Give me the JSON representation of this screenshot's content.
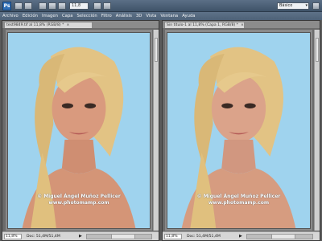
{
  "app": {
    "logo_text": "Ps",
    "zoom": "11,8",
    "workspace": "Básico"
  },
  "menu": [
    "Archivo",
    "Edición",
    "Imagen",
    "Capa",
    "Selección",
    "Filtro",
    "Análisis",
    "3D",
    "Vista",
    "Ventana",
    "Ayuda"
  ],
  "left_doc": {
    "tab_title": "test9849.tif al 11,8% (RGB/8) *",
    "close": "×",
    "watermark_line1": "© Miguel Ángel Muñoz Pellicer",
    "watermark_line2": "www.photomamp.com",
    "status_zoom": "11,8%",
    "status_info": "Doc: 51,4M/51,4M",
    "status_arrow": "▶"
  },
  "right_doc": {
    "tab_title": "Sin título-1 al 11,8% (Capa 1, RGB/8) *",
    "close": "×",
    "watermark_line1": "© Miguel Ángel Muñoz Pellicer",
    "watermark_line2": "www.photomamp.com",
    "status_zoom": "11,8%",
    "status_info": "Doc: 51,4M/51,4M",
    "status_arrow": "▶"
  },
  "colors": {
    "photo_background": "#9fd3ee",
    "hair": "#e2c384",
    "skin": "#d99a7e"
  }
}
